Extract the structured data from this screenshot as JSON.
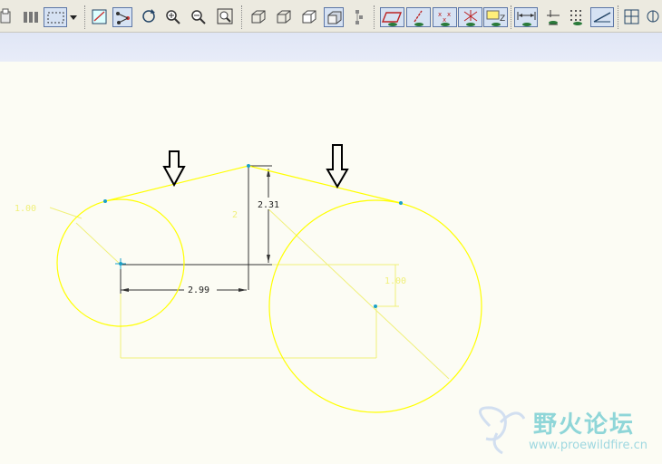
{
  "toolbar": {
    "buttons": [
      "print-icon",
      "pan-icon",
      "selection-box-icon",
      "dropdown-arrow-icon",
      "sketch-view-icon",
      "relations-icon",
      "repaint-icon",
      "zoom-in-icon",
      "zoom-out-icon",
      "refit-icon",
      "wireframe-icon",
      "hidden-line-icon",
      "no-hidden-icon",
      "shading-icon",
      "model-tree-icon",
      "datum-planes-icon",
      "datum-axes-icon",
      "datum-points-icon",
      "coordinate-systems-icon",
      "annotations-icon",
      "dimension-display-icon",
      "constraint-display-icon",
      "grid-display-icon",
      "vertex-display-icon",
      "sketch-settings-icon",
      "more-icon"
    ]
  },
  "sketch": {
    "dimensions": {
      "horizontal": "2.99",
      "vertical": "2.31",
      "vertical_small": "1.00",
      "left_radius": "1.00",
      "right_partial": "2"
    },
    "colors": {
      "geometry": "#ffff00",
      "weak_dimension": "#f0f07a",
      "strong_dimension": "#000000",
      "vertex": "#1aa0c8",
      "arrow": "#000000",
      "background": "#fcfcf4"
    }
  },
  "watermark": {
    "text": "野火论坛",
    "url": "www.proewildfire.cn"
  }
}
